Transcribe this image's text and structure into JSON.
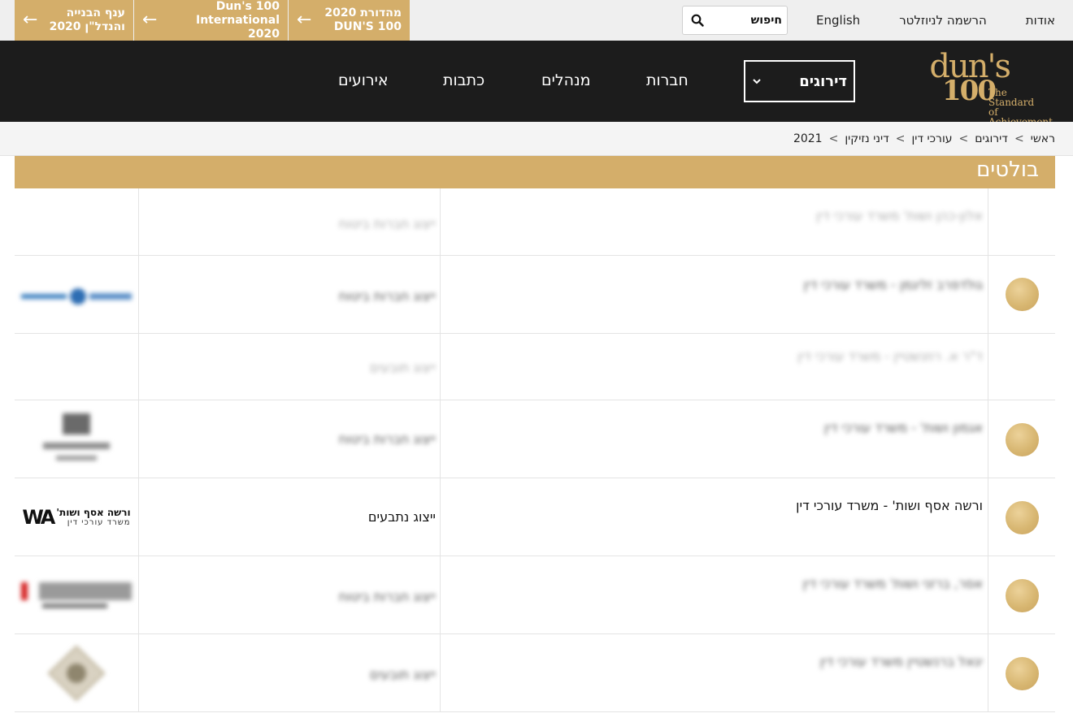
{
  "topbar": {
    "links": [
      "אודות",
      "הרשמה לניוזלטר",
      "English"
    ],
    "search_placeholder": "חיפוש",
    "promos": [
      {
        "line1": "מהדורת 2020",
        "line2": "DUN'S 100"
      },
      {
        "line1": "Dun's 100",
        "line2": "International 2020"
      },
      {
        "line1": "ענף הבנייה",
        "line2": "והנדל\"ן 2020"
      }
    ]
  },
  "logo": {
    "word": "dun's",
    "num": "100",
    "tagline_1": "The Standard",
    "tagline_2": "of Achievement"
  },
  "nav": {
    "dropdown_label": "דירוגים",
    "items": [
      "חברות",
      "מנהלים",
      "כתבות",
      "אירועים"
    ]
  },
  "breadcrumb": [
    "ראשי",
    "דירוגים",
    "עורכי דין",
    "דיני נזיקין",
    "2021"
  ],
  "breadcrumb_sep": ">",
  "section": {
    "title": "בולטים"
  },
  "rows": [
    {
      "firm": "אלון-כהן ושות' משרד עורכי דין",
      "rep": "ייצוג חברות ביטוח",
      "blurred": true,
      "faint": true,
      "medal": false,
      "logo": ""
    },
    {
      "firm": "גולדפרב זליגמן - משרד עורכי דין",
      "rep": "ייצוג חברות ביטוח",
      "blurred": true,
      "faint": false,
      "medal": true,
      "logo": "blue-wordmark"
    },
    {
      "firm": "ד\"ר א. רוזנשטיין - משרד עורכי דין",
      "rep": "ייצוג תובעים",
      "blurred": true,
      "faint": true,
      "medal": false,
      "logo": ""
    },
    {
      "firm": "אגמון ושות' - משרד עורכי דין",
      "rep": "ייצוג חברות ביטוח",
      "blurred": true,
      "faint": false,
      "medal": true,
      "logo": "gray-emblem"
    },
    {
      "firm": "ורשה אסף ושות' - משרד עורכי דין",
      "rep": "ייצוג נתבעים",
      "blurred": false,
      "faint": false,
      "medal": true,
      "logo": "wa",
      "logo_mark": "WA",
      "logo_name": "ורשה אסף ושות'",
      "logo_sub": "משרד עורכי דין"
    },
    {
      "firm": "אסר, ברזני ושות' משרד עורכי דין",
      "rep": "ייצוג חברות ביטוח",
      "blurred": true,
      "faint": false,
      "medal": true,
      "logo": "red-gray"
    },
    {
      "firm": "יגאל ברנשטיין משרד עורכי דין",
      "rep": "ייצוג תובעים",
      "blurred": true,
      "faint": false,
      "medal": true,
      "logo": "diamond"
    }
  ],
  "colors": {
    "gold": "#d4ae6a",
    "nav_bg": "#1c1c1c",
    "topbar_bg": "#efefef"
  }
}
